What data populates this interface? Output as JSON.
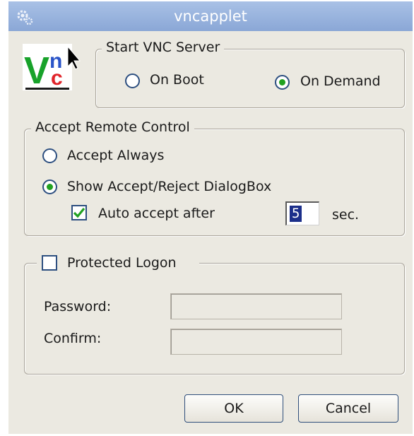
{
  "window": {
    "title": "vncapplet",
    "app_icon": "gear-icon"
  },
  "logo": {
    "text_v": "V",
    "text_n": "n",
    "text_c": "c",
    "icon": "vnc-logo"
  },
  "start_server": {
    "legend": "Start VNC Server",
    "options": [
      {
        "label": "On Boot",
        "selected": false
      },
      {
        "label": "On Demand",
        "selected": true
      }
    ]
  },
  "remote_control": {
    "legend": "Accept Remote Control",
    "options": [
      {
        "label": "Accept Always",
        "selected": false
      },
      {
        "label": "Show Accept/Reject DialogBox",
        "selected": true
      }
    ],
    "auto_accept": {
      "label": "Auto accept after",
      "checked": true,
      "value": "5",
      "unit": "sec."
    }
  },
  "protected_logon": {
    "label": "Protected Logon",
    "checked": false,
    "password_label": "Password:",
    "password_value": "",
    "confirm_label": "Confirm:",
    "confirm_value": ""
  },
  "buttons": {
    "ok": "OK",
    "cancel": "Cancel"
  },
  "colors": {
    "titlebar": "#9bb5df",
    "radio_dot": "#21a121",
    "check_mark": "#21a121",
    "border_blue": "#2d4f80"
  }
}
